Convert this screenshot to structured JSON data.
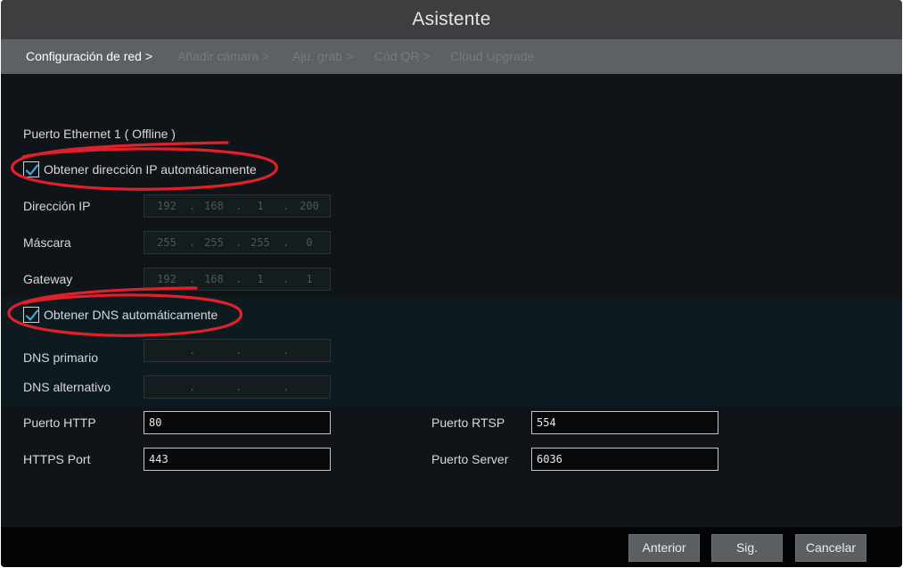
{
  "window": {
    "title": "Asistente"
  },
  "steps": [
    {
      "label": "Configuración de red >",
      "state": "active"
    },
    {
      "label": "Añadir cámara >",
      "state": "inactive"
    },
    {
      "label": "Aju. grab >",
      "state": "inactive"
    },
    {
      "label": "Cód QR >",
      "state": "inactive"
    },
    {
      "label": "Cloud Upgrade",
      "state": "inactive"
    }
  ],
  "network": {
    "port_title": "Puerto Ethernet 1 ( Offline )",
    "auto_ip": {
      "label": "Obtener dirección IP automáticamente",
      "checked": true
    },
    "ip": {
      "label": "Dirección IP",
      "octets": [
        "192",
        "168",
        "1",
        "200"
      ]
    },
    "mask": {
      "label": "Máscara",
      "octets": [
        "255",
        "255",
        "255",
        "0"
      ]
    },
    "gateway": {
      "label": "Gateway",
      "octets": [
        "192",
        "168",
        "1",
        "1"
      ]
    },
    "auto_dns": {
      "label": "Obtener DNS automáticamente",
      "checked": true
    },
    "dns_primary": {
      "label": "DNS primario",
      "octets": [
        "",
        "",
        "",
        ""
      ]
    },
    "dns_alt": {
      "label": "DNS alternativo",
      "octets": [
        "",
        "",
        "",
        ""
      ]
    }
  },
  "ports": {
    "http": {
      "label": "Puerto HTTP",
      "value": "80"
    },
    "https": {
      "label": "HTTPS Port",
      "value": "443"
    },
    "rtsp": {
      "label": "Puerto RTSP",
      "value": "554"
    },
    "server": {
      "label": "Puerto Server",
      "value": "6036"
    }
  },
  "buttons": {
    "previous": "Anterior",
    "next": "Sig.",
    "cancel": "Cancelar"
  },
  "colors": {
    "annotation": "#e0202a",
    "check": "#4aa8d8"
  }
}
